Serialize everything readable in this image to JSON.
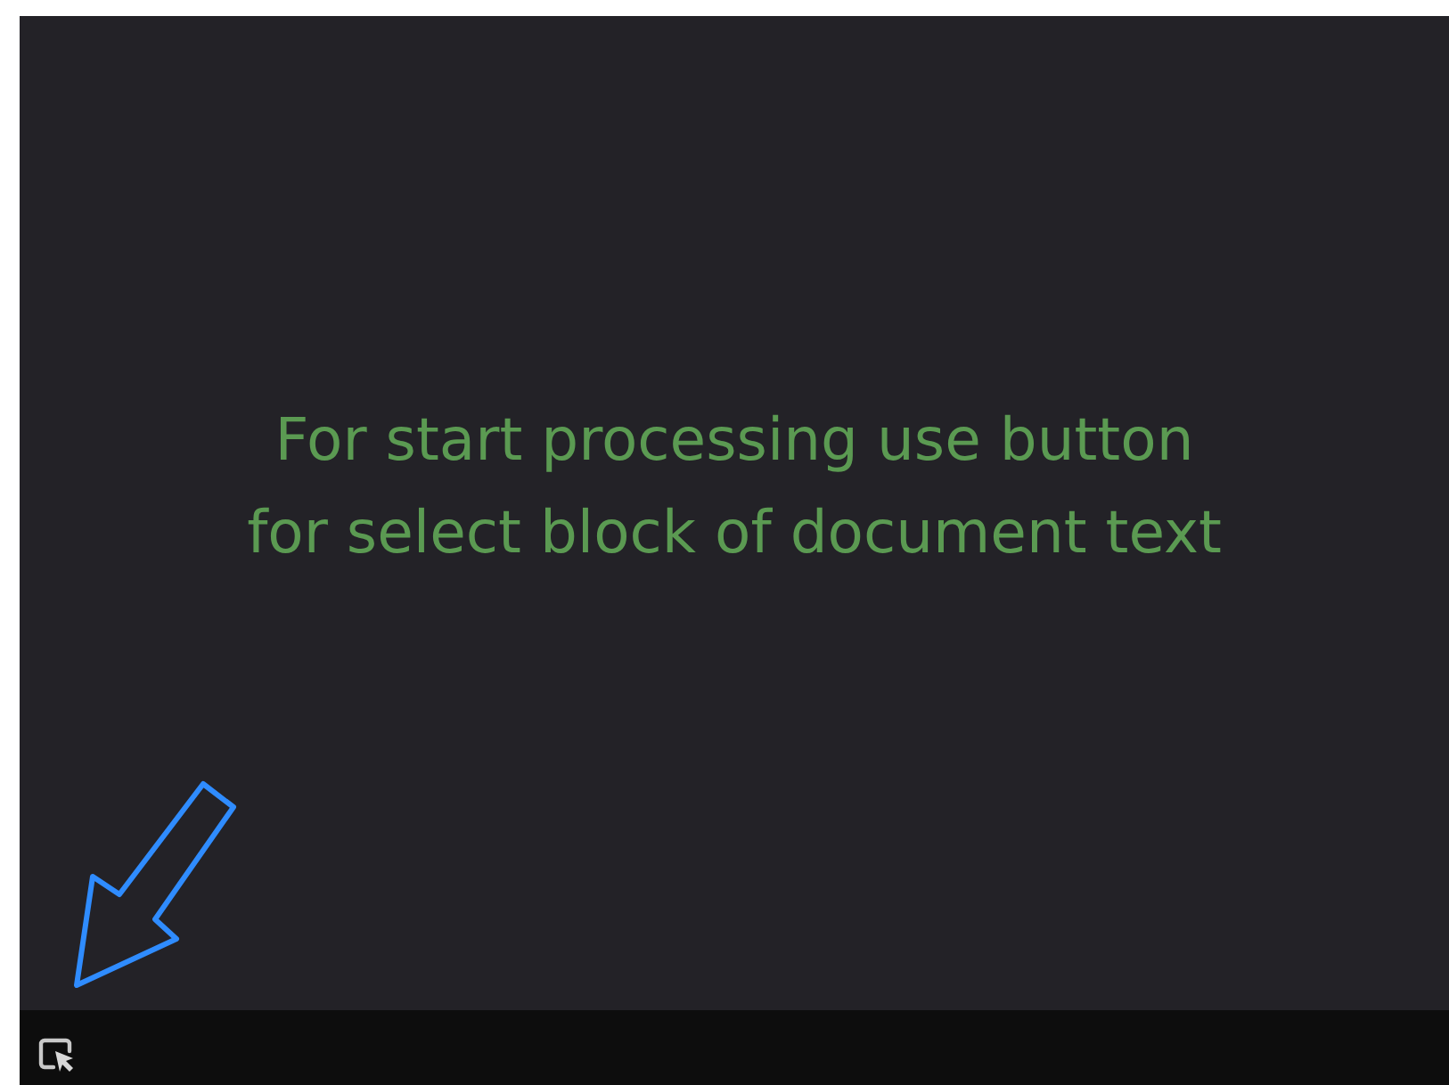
{
  "message": "For start processing use button\nfor select block of document text",
  "toolbar": {
    "buttons": [
      {
        "kind": "select-block"
      }
    ]
  }
}
